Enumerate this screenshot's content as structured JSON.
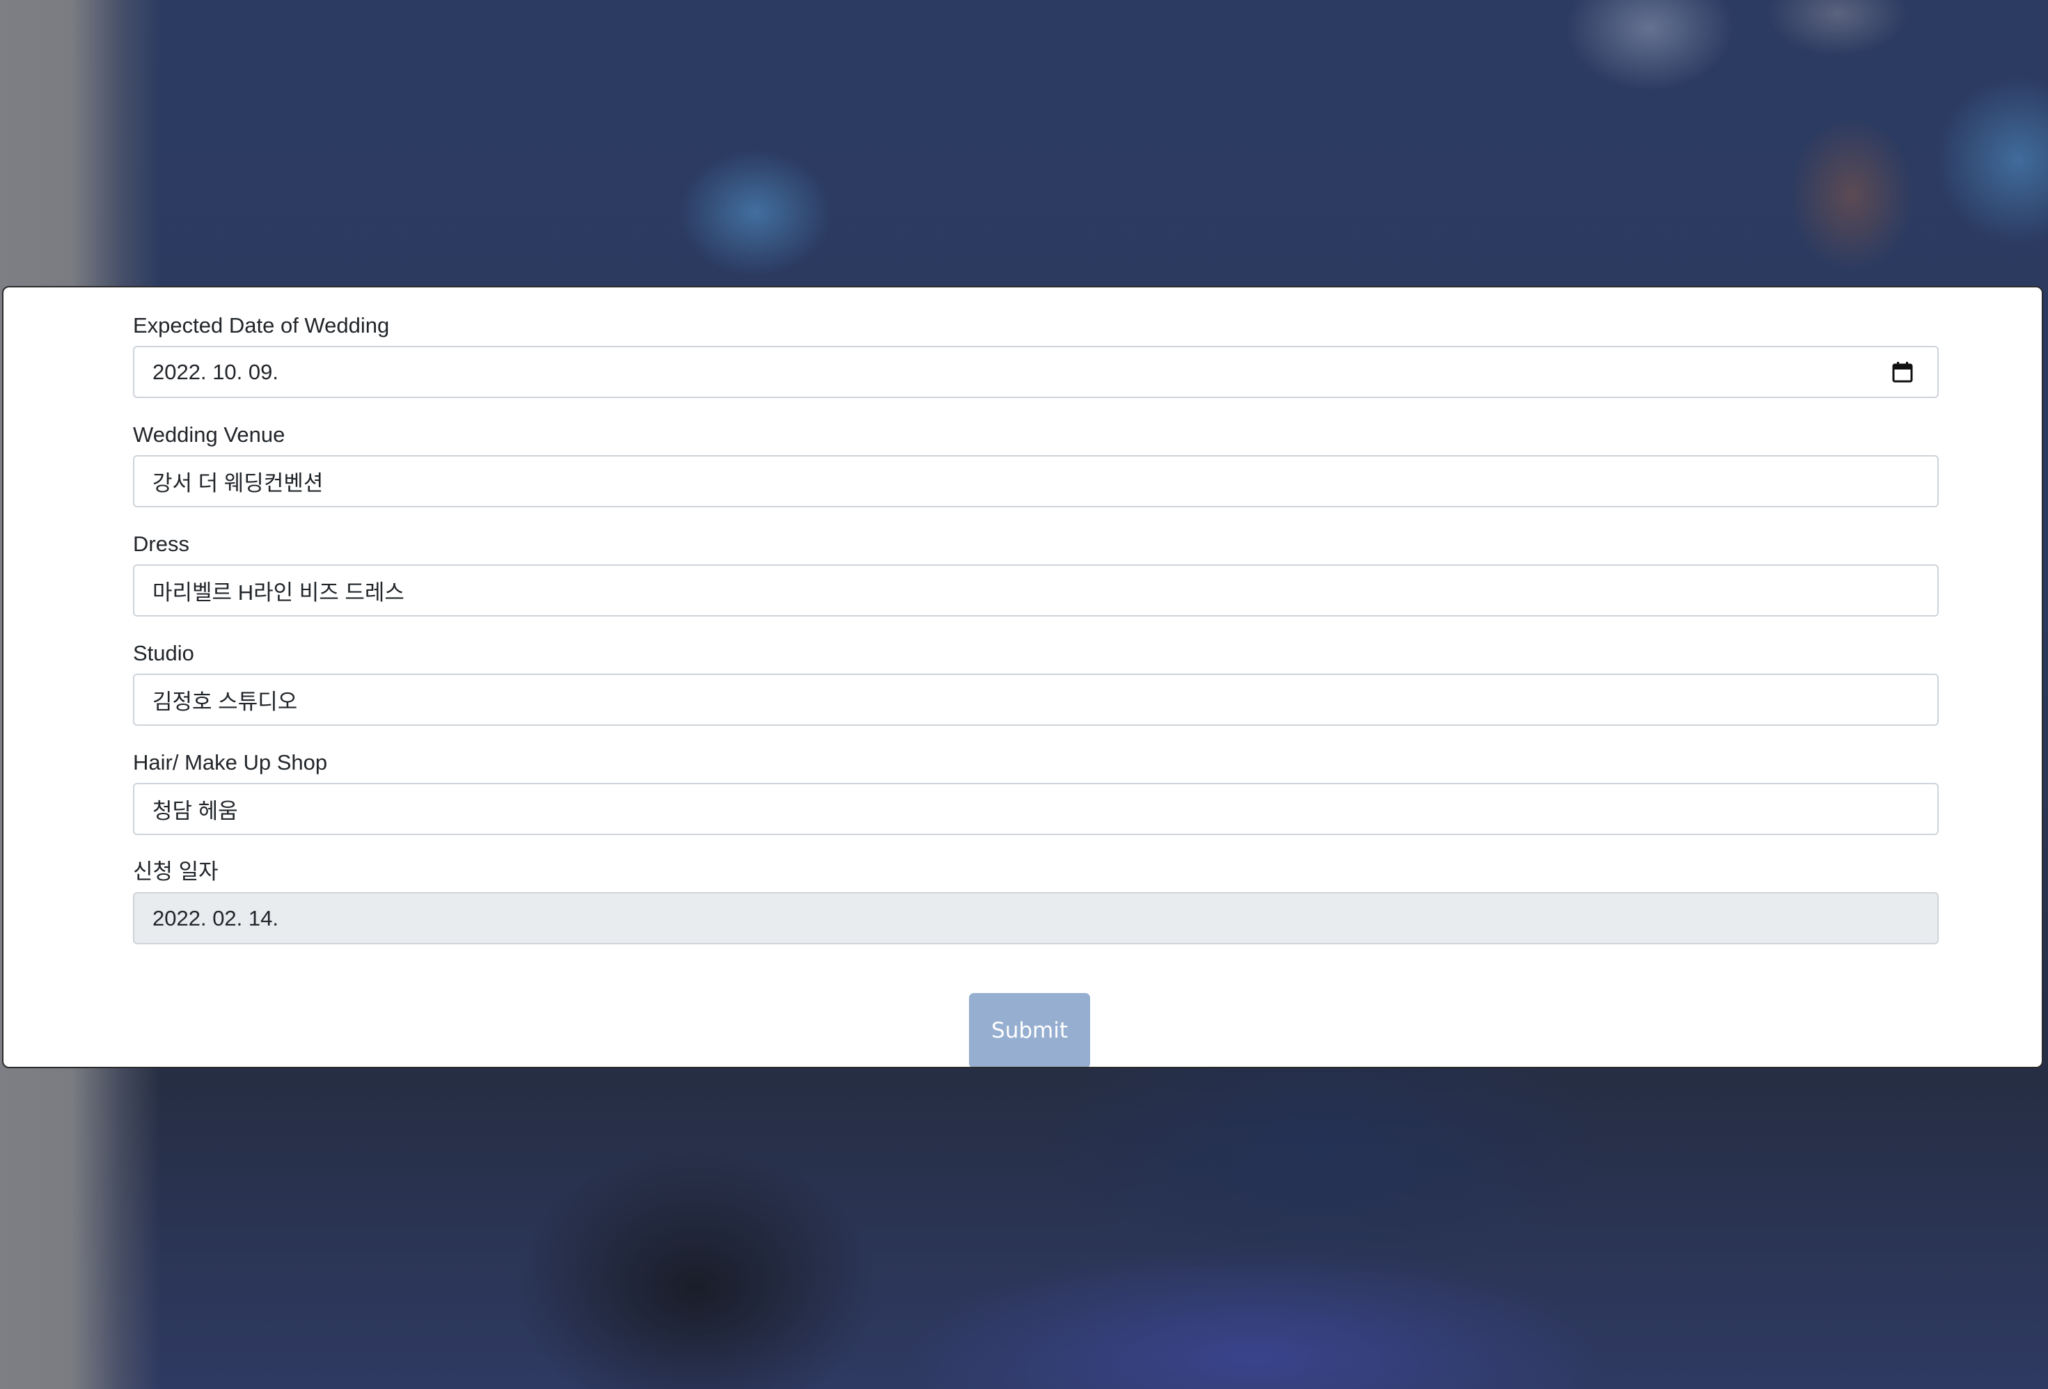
{
  "form": {
    "fields": [
      {
        "label": "Expected Date of Wedding",
        "value": "2022. 10. 09.",
        "type": "date"
      },
      {
        "label": "Wedding Venue",
        "value": "강서 더 웨딩컨벤션",
        "type": "text"
      },
      {
        "label": "Dress",
        "value": "마리벨르 H라인 비즈 드레스",
        "type": "text"
      },
      {
        "label": "Studio",
        "value": "김정호 스튜디오",
        "type": "text"
      },
      {
        "label": "Hair/ Make Up Shop",
        "value": "청담 헤움",
        "type": "text"
      },
      {
        "label": "신청 일자",
        "value": "2022. 02. 14.",
        "type": "readonly"
      }
    ],
    "submit_label": "Submit"
  },
  "icons": {
    "date_picker": "calendar-icon"
  },
  "colors": {
    "submit_bg": "#96aed0",
    "readonly_bg": "#e9ecef",
    "input_border": "#ced4da"
  }
}
